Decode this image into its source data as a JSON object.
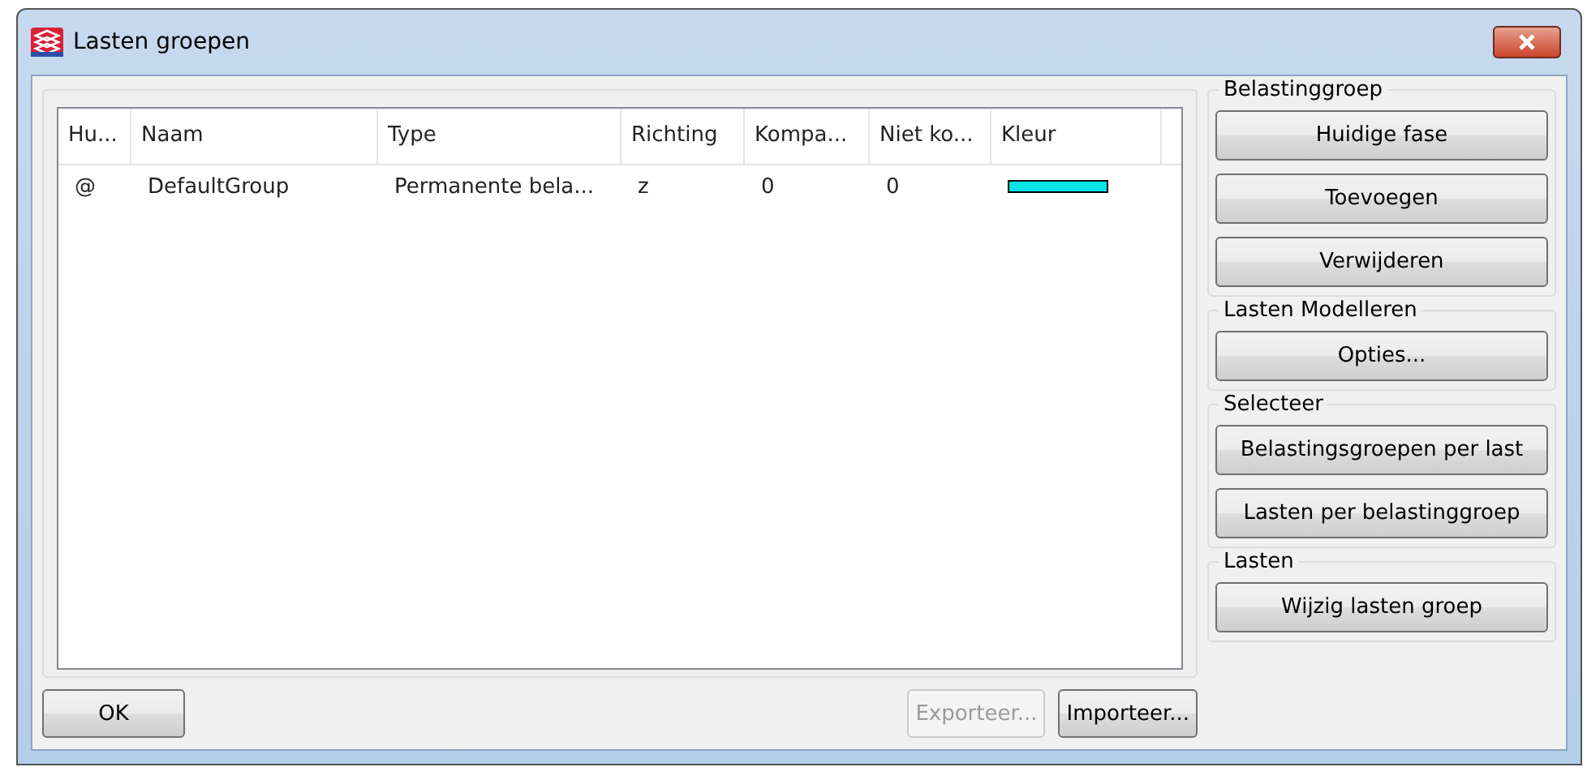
{
  "window": {
    "title": "Lasten groepen"
  },
  "table": {
    "columns": [
      "Hu...",
      "Naam",
      "Type",
      "Richting",
      "Kompa...",
      "Niet ko...",
      "Kleur"
    ],
    "rows": [
      {
        "cells": [
          "@",
          "DefaultGroup",
          "Permanente bela...",
          "z",
          "0",
          "0"
        ],
        "color": "#00e5e5"
      }
    ]
  },
  "groups": [
    {
      "title": "Belastinggroep",
      "buttons": [
        {
          "label": "Huidige fase",
          "disabled": false
        },
        {
          "label": "Toevoegen",
          "disabled": false
        },
        {
          "label": "Verwijderen",
          "disabled": false
        }
      ]
    },
    {
      "title": "Lasten Modelleren",
      "buttons": [
        {
          "label": "Opties...",
          "disabled": false
        }
      ]
    },
    {
      "title": "Selecteer",
      "buttons": [
        {
          "label": "Belastingsgroepen per last",
          "disabled": false
        },
        {
          "label": "Lasten per belastinggroep",
          "disabled": false
        }
      ]
    },
    {
      "title": "Lasten",
      "buttons": [
        {
          "label": "Wijzig lasten groep",
          "disabled": false
        }
      ]
    }
  ],
  "footer": {
    "ok": {
      "label": "OK",
      "disabled": false
    },
    "actions": [
      {
        "label": "Exporteer...",
        "disabled": true
      },
      {
        "label": "Importeer...",
        "disabled": false
      }
    ]
  }
}
